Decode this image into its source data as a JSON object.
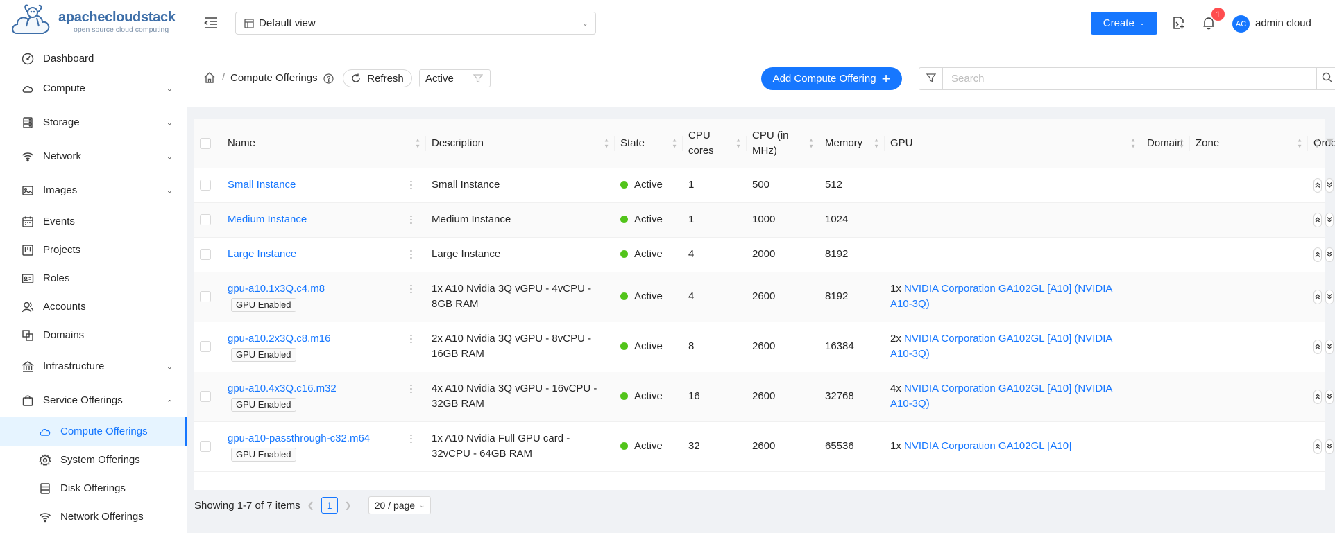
{
  "brand": {
    "name_bold": "apache",
    "name_light": "cloudstack",
    "tagline": "open source cloud computing"
  },
  "sidebar": {
    "items": [
      {
        "label": "Dashboard",
        "icon": "dashboard-icon"
      },
      {
        "label": "Compute",
        "icon": "cloud-icon"
      },
      {
        "label": "Storage",
        "icon": "database-icon"
      },
      {
        "label": "Network",
        "icon": "wifi-icon"
      },
      {
        "label": "Images",
        "icon": "picture-icon"
      },
      {
        "label": "Events",
        "icon": "schedule-icon"
      },
      {
        "label": "Projects",
        "icon": "project-icon"
      },
      {
        "label": "Roles",
        "icon": "idcard-icon"
      },
      {
        "label": "Accounts",
        "icon": "team-icon"
      },
      {
        "label": "Domains",
        "icon": "block-icon"
      },
      {
        "label": "Infrastructure",
        "icon": "bank-icon"
      },
      {
        "label": "Service Offerings",
        "icon": "shopping-icon"
      }
    ],
    "sub_items": [
      {
        "label": "Compute Offerings",
        "icon": "cloud-icon"
      },
      {
        "label": "System Offerings",
        "icon": "setting-icon"
      },
      {
        "label": "Disk Offerings",
        "icon": "hdd-icon"
      },
      {
        "label": "Network Offerings",
        "icon": "wifi-icon"
      }
    ]
  },
  "header": {
    "view_select": "Default view",
    "create_label": "Create",
    "notification_count": "1",
    "avatar_initials": "AC",
    "user_name": "admin cloud"
  },
  "toolbar": {
    "breadcrumb_title": "Compute Offerings",
    "refresh_label": "Refresh",
    "state_filter": "Active",
    "add_label": "Add Compute Offering",
    "search_placeholder": "Search"
  },
  "table": {
    "columns": [
      "Name",
      "Description",
      "State",
      "CPU cores",
      "CPU (in MHz)",
      "Memory",
      "GPU",
      "Domain",
      "Zone",
      "Order"
    ],
    "gpu_tag": "GPU Enabled",
    "rows": [
      {
        "name": "Small Instance",
        "gpu_enabled": false,
        "description": "Small Instance",
        "state": "Active",
        "cpu_cores": "1",
        "cpu_mhz": "500",
        "memory": "512",
        "gpu_count": "",
        "gpu_name": ""
      },
      {
        "name": "Medium Instance",
        "gpu_enabled": false,
        "description": "Medium Instance",
        "state": "Active",
        "cpu_cores": "1",
        "cpu_mhz": "1000",
        "memory": "1024",
        "gpu_count": "",
        "gpu_name": ""
      },
      {
        "name": "Large Instance",
        "gpu_enabled": false,
        "description": "Large Instance",
        "state": "Active",
        "cpu_cores": "4",
        "cpu_mhz": "2000",
        "memory": "8192",
        "gpu_count": "",
        "gpu_name": ""
      },
      {
        "name": "gpu-a10.1x3Q.c4.m8",
        "gpu_enabled": true,
        "description": "1x A10 Nvidia 3Q vGPU - 4vCPU - 8GB RAM",
        "state": "Active",
        "cpu_cores": "4",
        "cpu_mhz": "2600",
        "memory": "8192",
        "gpu_count": "1x",
        "gpu_name": "NVIDIA Corporation GA102GL [A10] (NVIDIA A10-3Q)"
      },
      {
        "name": "gpu-a10.2x3Q.c8.m16",
        "gpu_enabled": true,
        "description": "2x A10 Nvidia 3Q vGPU - 8vCPU - 16GB RAM",
        "state": "Active",
        "cpu_cores": "8",
        "cpu_mhz": "2600",
        "memory": "16384",
        "gpu_count": "2x",
        "gpu_name": "NVIDIA Corporation GA102GL [A10] (NVIDIA A10-3Q)"
      },
      {
        "name": "gpu-a10.4x3Q.c16.m32",
        "gpu_enabled": true,
        "description": "4x A10 Nvidia 3Q vGPU - 16vCPU - 32GB RAM",
        "state": "Active",
        "cpu_cores": "16",
        "cpu_mhz": "2600",
        "memory": "32768",
        "gpu_count": "4x",
        "gpu_name": "NVIDIA Corporation GA102GL [A10] (NVIDIA A10-3Q)"
      },
      {
        "name": "gpu-a10-passthrough-c32.m64",
        "gpu_enabled": true,
        "description": "1x A10 Nvidia Full GPU card - 32vCPU - 64GB RAM",
        "state": "Active",
        "cpu_cores": "32",
        "cpu_mhz": "2600",
        "memory": "65536",
        "gpu_count": "1x",
        "gpu_name": "NVIDIA Corporation GA102GL [A10]"
      }
    ]
  },
  "pagination": {
    "summary": "Showing 1-7 of 7 items",
    "current_page": "1",
    "page_size": "20 / page"
  },
  "colors": {
    "primary": "#1677ff",
    "active_dot": "#52c41a",
    "badge": "#ff4d4f"
  }
}
